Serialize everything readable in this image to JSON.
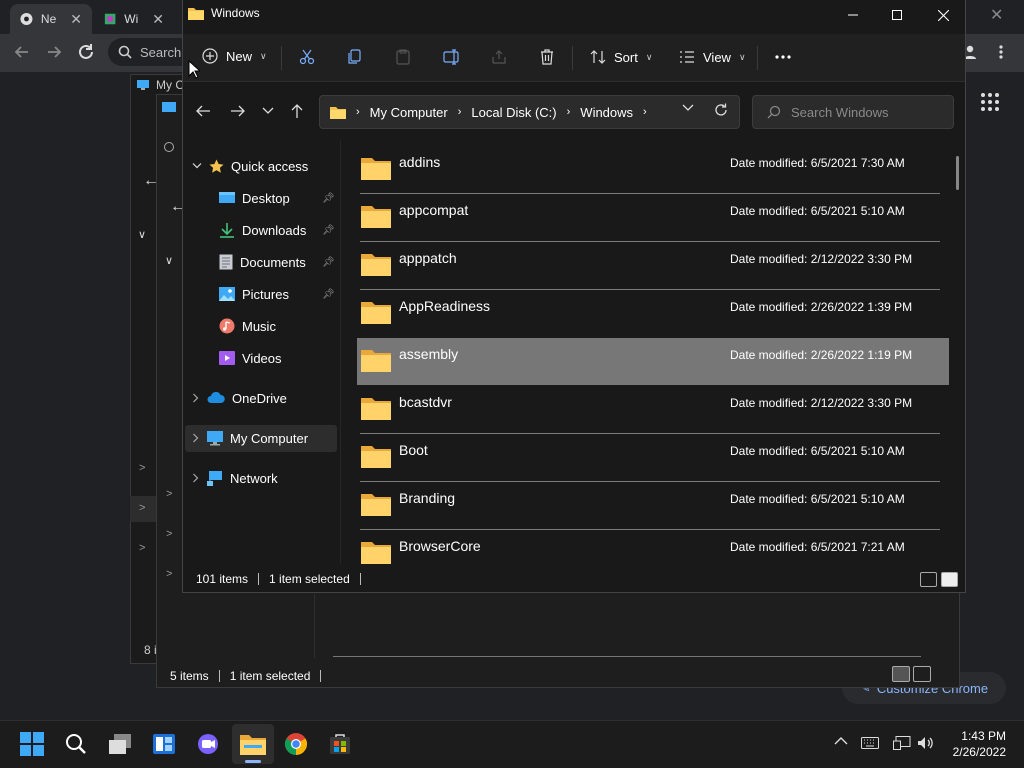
{
  "chrome": {
    "tabs": [
      {
        "label": "Ne",
        "icon": "chrome-icon"
      },
      {
        "label": "Wi",
        "icon": "site-icon"
      }
    ],
    "omnibox_placeholder": "Search",
    "customize_label": "Customize Chrome"
  },
  "bg_windows": {
    "win1_title": "My C",
    "win1_status": "8 i",
    "win2_status": {
      "items": "5 items",
      "selected": "1 item selected"
    }
  },
  "explorer": {
    "title": "Windows",
    "toolbar": {
      "new": "New",
      "sort": "Sort",
      "view": "View"
    },
    "address": [
      "My Computer",
      "Local Disk (C:)",
      "Windows"
    ],
    "search_placeholder": "Search Windows",
    "nav": {
      "quick_access": "Quick access",
      "desktop": "Desktop",
      "downloads": "Downloads",
      "documents": "Documents",
      "pictures": "Pictures",
      "music": "Music",
      "videos": "Videos",
      "onedrive": "OneDrive",
      "my_computer": "My Computer",
      "network": "Network"
    },
    "files": [
      {
        "name": "addins",
        "date": "Date modified: 6/5/2021 7:30 AM"
      },
      {
        "name": "appcompat",
        "date": "Date modified: 6/5/2021 5:10 AM"
      },
      {
        "name": "apppatch",
        "date": "Date modified: 2/12/2022 3:30 PM"
      },
      {
        "name": "AppReadiness",
        "date": "Date modified: 2/26/2022 1:39 PM"
      },
      {
        "name": "assembly",
        "date": "Date modified: 2/26/2022 1:19 PM"
      },
      {
        "name": "bcastdvr",
        "date": "Date modified: 2/12/2022 3:30 PM"
      },
      {
        "name": "Boot",
        "date": "Date modified: 6/5/2021 5:10 AM"
      },
      {
        "name": "Branding",
        "date": "Date modified: 6/5/2021 5:10 AM"
      },
      {
        "name": "BrowserCore",
        "date": "Date modified: 6/5/2021 7:21 AM"
      }
    ],
    "selected_index": 4,
    "status": {
      "items": "101 items",
      "selected": "1 item selected"
    }
  },
  "taskbar": {
    "time": "1:43 PM",
    "date": "2/26/2022"
  },
  "colors": {
    "folder": "#f4c04e",
    "accent": "#8cb4ff",
    "selection": "#777777"
  }
}
